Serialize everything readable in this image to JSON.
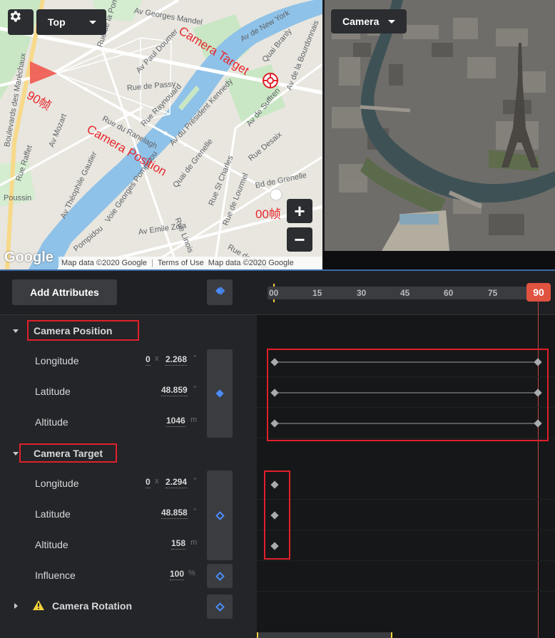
{
  "map": {
    "view_mode": "Top",
    "streets": [
      "Av Georges Mandel",
      "Rue de la Pompe",
      "Av Paul Doumer",
      "Rue de Passy",
      "Av de New York",
      "Quai Branly",
      "Av de la Bourdonnais",
      "Av de Suffren",
      "Rue Desaix",
      "Rue Raynouard",
      "Av du Président Kennedy",
      "Rue du Ranelagh",
      "Av Mozart",
      "Rue Raffet",
      "Av Théophile Gautier",
      "Voie Georges Pompidou",
      "Quai de Grenelle",
      "Rue St Charles",
      "Bd de Grenelle",
      "Rue de Lourmel",
      "Rue Linois",
      "Av Emile Zola",
      "Poussin",
      "Pompidou",
      "Rue de l'Entrepreneurs",
      "Boulevards des Maréchaux"
    ],
    "annotations": {
      "camera_target": "Camera Target",
      "camera_position": "Camera Position",
      "frame_end": "90帧",
      "frame_start": "00帧"
    },
    "zoom_in": "+",
    "zoom_out": "−",
    "logo": "Google",
    "attribution": [
      "Map data ©2020 Google",
      "Terms of Use",
      "Map data ©2020 Google"
    ]
  },
  "camera_view": {
    "mode": "Camera"
  },
  "timeline": {
    "add_attributes": "Add Attributes",
    "ticks": [
      "00",
      "15",
      "30",
      "45",
      "60",
      "75"
    ],
    "current_frame": "90",
    "sections": {
      "camera_position": {
        "title": "Camera Position",
        "rows": [
          {
            "label": "Longitude",
            "prefix": "0",
            "sep": "x",
            "value": "2.268",
            "unit": "°"
          },
          {
            "label": "Latitude",
            "value": "48.859",
            "unit": "°"
          },
          {
            "label": "Altitude",
            "value": "1046",
            "unit": "m"
          }
        ]
      },
      "camera_target": {
        "title": "Camera Target",
        "rows": [
          {
            "label": "Longitude",
            "prefix": "0",
            "sep": "x",
            "value": "2.294",
            "unit": "°"
          },
          {
            "label": "Latitude",
            "value": "48.858",
            "unit": "°"
          },
          {
            "label": "Altitude",
            "value": "158",
            "unit": "m"
          },
          {
            "label": "Influence",
            "value": "100",
            "unit": "%"
          }
        ]
      },
      "camera_rotation": {
        "title": "Camera Rotation"
      }
    }
  },
  "colors": {
    "accent_red": "#e0202a",
    "frame_badge": "#e05340",
    "keyframe_blue": "#4a8cf7"
  }
}
